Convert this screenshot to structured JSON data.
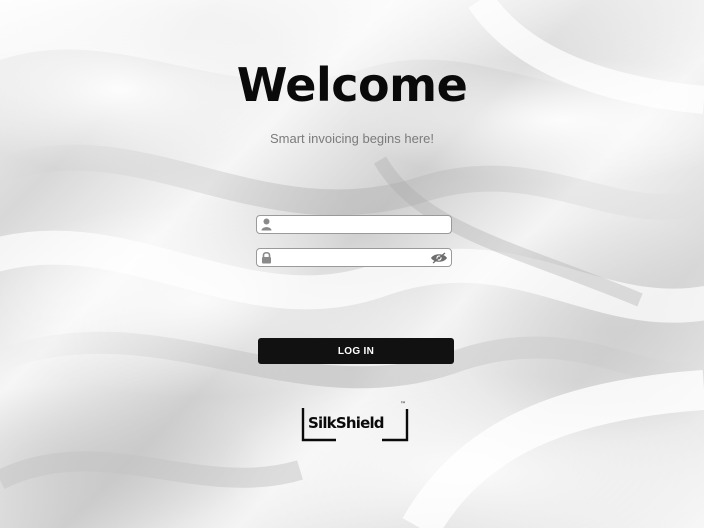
{
  "header": {
    "title": "Welcome",
    "subtitle": "Smart invoicing begins here!"
  },
  "form": {
    "username": {
      "value": "",
      "placeholder": "",
      "icon": "user-icon"
    },
    "password": {
      "value": "",
      "placeholder": "",
      "icon": "lock-icon",
      "toggle_icon": "eye-icon"
    },
    "login_label": "LOG IN"
  },
  "brand": {
    "name": "SilkShield",
    "trademark": "™"
  },
  "colors": {
    "button_bg": "#111111",
    "button_text": "#ffffff",
    "title": "#0a0a0a",
    "subtitle": "#7b7b7b"
  }
}
